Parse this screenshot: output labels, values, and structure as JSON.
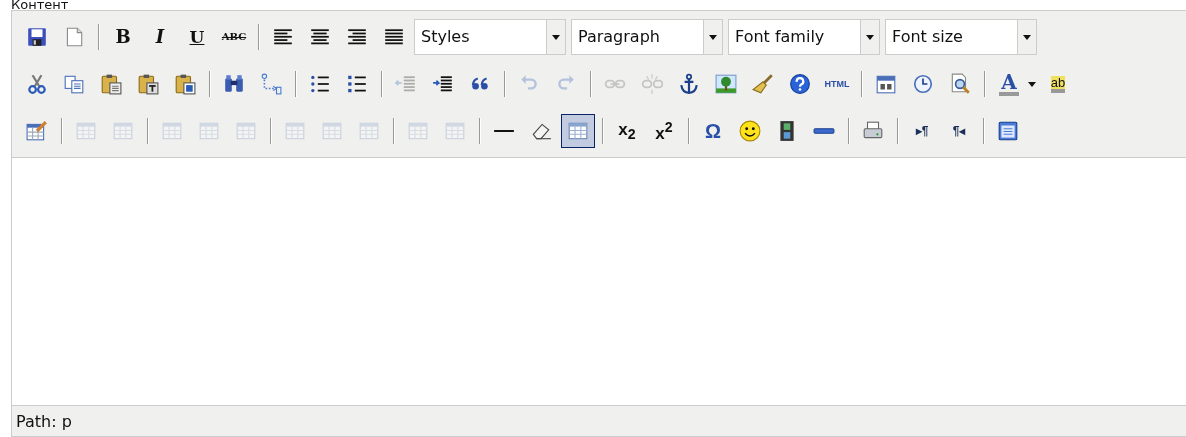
{
  "field_label": "Контент",
  "toolbars": [
    {
      "items": [
        {
          "kind": "button",
          "disabled": false,
          "active": false
        },
        {
          "kind": "button",
          "disabled": false,
          "active": false
        },
        {
          "kind": "separator"
        },
        {
          "kind": "button",
          "glyph": "B",
          "disabled": false,
          "active": false
        },
        {
          "kind": "button",
          "glyph": "I",
          "disabled": false,
          "active": false
        },
        {
          "kind": "button",
          "glyph": "U",
          "disabled": false,
          "active": false
        },
        {
          "kind": "button",
          "glyph": "ABC",
          "disabled": false,
          "active": false
        },
        {
          "kind": "separator"
        },
        {
          "kind": "button",
          "disabled": false,
          "active": false
        },
        {
          "kind": "button",
          "disabled": false,
          "active": false
        },
        {
          "kind": "button",
          "disabled": false,
          "active": false
        },
        {
          "kind": "button",
          "disabled": false,
          "active": false
        },
        {
          "kind": "select",
          "label": "Styles"
        },
        {
          "kind": "select",
          "label": "Paragraph"
        },
        {
          "kind": "select",
          "label": "Font family"
        },
        {
          "kind": "select",
          "label": "Font size"
        }
      ]
    },
    {
      "items": [
        {
          "kind": "button",
          "disabled": false,
          "active": false
        },
        {
          "kind": "button",
          "disabled": false,
          "active": false
        },
        {
          "kind": "button",
          "disabled": false,
          "active": false
        },
        {
          "kind": "button",
          "disabled": false,
          "active": false
        },
        {
          "kind": "button",
          "disabled": false,
          "active": false
        },
        {
          "kind": "separator"
        },
        {
          "kind": "button",
          "disabled": false,
          "active": false
        },
        {
          "kind": "button",
          "disabled": false,
          "active": false
        },
        {
          "kind": "separator"
        },
        {
          "kind": "button",
          "disabled": false,
          "active": false
        },
        {
          "kind": "button",
          "disabled": false,
          "active": false
        },
        {
          "kind": "separator"
        },
        {
          "kind": "button",
          "disabled": true,
          "active": false
        },
        {
          "kind": "button",
          "disabled": false,
          "active": false
        },
        {
          "kind": "button",
          "disabled": false,
          "active": false
        },
        {
          "kind": "separator"
        },
        {
          "kind": "button",
          "disabled": true,
          "active": false
        },
        {
          "kind": "button",
          "disabled": true,
          "active": false
        },
        {
          "kind": "separator"
        },
        {
          "kind": "button",
          "disabled": true,
          "active": false
        },
        {
          "kind": "button",
          "disabled": true,
          "active": false
        },
        {
          "kind": "button",
          "disabled": false,
          "active": false
        },
        {
          "kind": "button",
          "disabled": false,
          "active": false
        },
        {
          "kind": "button",
          "disabled": false,
          "active": false
        },
        {
          "kind": "button",
          "disabled": false,
          "active": false
        },
        {
          "kind": "button",
          "glyph": "HTML",
          "disabled": false,
          "active": false
        },
        {
          "kind": "separator"
        },
        {
          "kind": "button",
          "disabled": false,
          "active": false
        },
        {
          "kind": "button",
          "disabled": false,
          "active": false
        },
        {
          "kind": "button",
          "disabled": false,
          "active": false
        },
        {
          "kind": "separator"
        },
        {
          "kind": "button",
          "glyph": "A",
          "disabled": false,
          "active": false
        },
        {
          "kind": "arrow"
        },
        {
          "kind": "button",
          "glyph": "ab",
          "disabled": false,
          "active": false
        }
      ]
    },
    {
      "items": [
        {
          "kind": "button",
          "disabled": false,
          "active": false
        },
        {
          "kind": "separator"
        },
        {
          "kind": "button",
          "disabled": true,
          "active": false
        },
        {
          "kind": "button",
          "disabled": true,
          "active": false
        },
        {
          "kind": "separator"
        },
        {
          "kind": "button",
          "disabled": true,
          "active": false
        },
        {
          "kind": "button",
          "disabled": true,
          "active": false
        },
        {
          "kind": "button",
          "disabled": true,
          "active": false
        },
        {
          "kind": "separator"
        },
        {
          "kind": "button",
          "disabled": true,
          "active": false
        },
        {
          "kind": "button",
          "disabled": true,
          "active": false
        },
        {
          "kind": "button",
          "disabled": true,
          "active": false
        },
        {
          "kind": "separator"
        },
        {
          "kind": "button",
          "disabled": true,
          "active": false
        },
        {
          "kind": "button",
          "disabled": true,
          "active": false
        },
        {
          "kind": "separator"
        },
        {
          "kind": "button",
          "disabled": false,
          "active": false
        },
        {
          "kind": "button",
          "disabled": false,
          "active": false
        },
        {
          "kind": "button",
          "disabled": false,
          "active": true
        },
        {
          "kind": "separator"
        },
        {
          "kind": "button",
          "glyph": "x$_{2}$",
          "disabled": false,
          "active": false
        },
        {
          "kind": "button",
          "glyph": "x$^{2}$",
          "disabled": false,
          "active": false
        },
        {
          "kind": "separator"
        },
        {
          "kind": "button",
          "glyph": "Ω",
          "disabled": false,
          "active": false
        },
        {
          "kind": "button",
          "disabled": false,
          "active": false
        },
        {
          "kind": "button",
          "disabled": false,
          "active": false
        },
        {
          "kind": "button",
          "disabled": false,
          "active": false
        },
        {
          "kind": "separator"
        },
        {
          "kind": "button",
          "disabled": false,
          "active": false
        },
        {
          "kind": "separator"
        },
        {
          "kind": "button",
          "glyph": "▸¶",
          "disabled": false,
          "active": false
        },
        {
          "kind": "button",
          "glyph": "¶◂",
          "disabled": false,
          "active": false
        },
        {
          "kind": "separator"
        },
        {
          "kind": "button",
          "disabled": false,
          "active": false
        }
      ]
    }
  ],
  "status_bar": {
    "path": "Path: p"
  }
}
